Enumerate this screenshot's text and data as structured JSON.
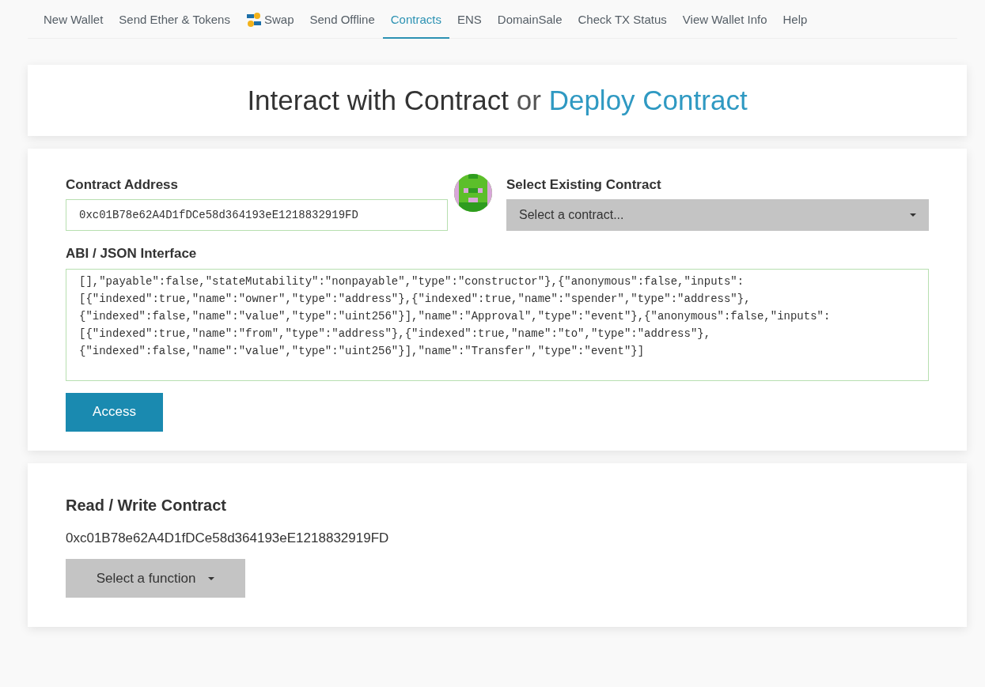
{
  "nav": [
    {
      "label": "New Wallet",
      "selected": false,
      "kind": "text"
    },
    {
      "label": "Send Ether & Tokens",
      "selected": false,
      "kind": "text"
    },
    {
      "label": "Swap",
      "selected": false,
      "kind": "swap"
    },
    {
      "label": "Send Offline",
      "selected": false,
      "kind": "text"
    },
    {
      "label": "Contracts",
      "selected": true,
      "kind": "text"
    },
    {
      "label": "ENS",
      "selected": false,
      "kind": "text"
    },
    {
      "label": "DomainSale",
      "selected": false,
      "kind": "text"
    },
    {
      "label": "Check TX Status",
      "selected": false,
      "kind": "text"
    },
    {
      "label": "View Wallet Info",
      "selected": false,
      "kind": "text"
    },
    {
      "label": "Help",
      "selected": false,
      "kind": "text"
    }
  ],
  "header": {
    "title": "Interact with Contract",
    "joiner": "or",
    "link": "Deploy Contract"
  },
  "contract_address": {
    "label": "Contract Address",
    "value": "0xc01B78e62A4D1fDCe58d364193eE1218832919FD"
  },
  "select_existing": {
    "label": "Select Existing Contract",
    "value": "Select a contract..."
  },
  "abi": {
    "label": "ABI / JSON Interface",
    "lines": [
      "[],\"payable\":false,\"stateMutability\":\"nonpayable\",\"type\":\"constructor\"},{\"anonymous\":false,\"inputs\":",
      "[{\"indexed\":true,\"name\":\"owner\",\"type\":\"address\"},{\"indexed\":true,\"name\":\"spender\",\"type\":\"address\"},",
      "{\"indexed\":false,\"name\":\"value\",\"type\":\"uint256\"}],\"name\":\"Approval\",\"type\":\"event\"},{\"anonymous\":false,\"inputs\":",
      "[{\"indexed\":true,\"name\":\"from\",\"type\":\"address\"},{\"indexed\":true,\"name\":\"to\",\"type\":\"address\"},",
      "{\"indexed\":false,\"name\":\"value\",\"type\":\"uint256\"}],\"name\":\"Transfer\",\"type\":\"event\"}]"
    ]
  },
  "access_button": "Access",
  "read_write": {
    "title": "Read / Write Contract",
    "address": "0xc01B78e62A4D1fDCe58d364193eE1218832919FD",
    "function_button": "Select a function"
  }
}
